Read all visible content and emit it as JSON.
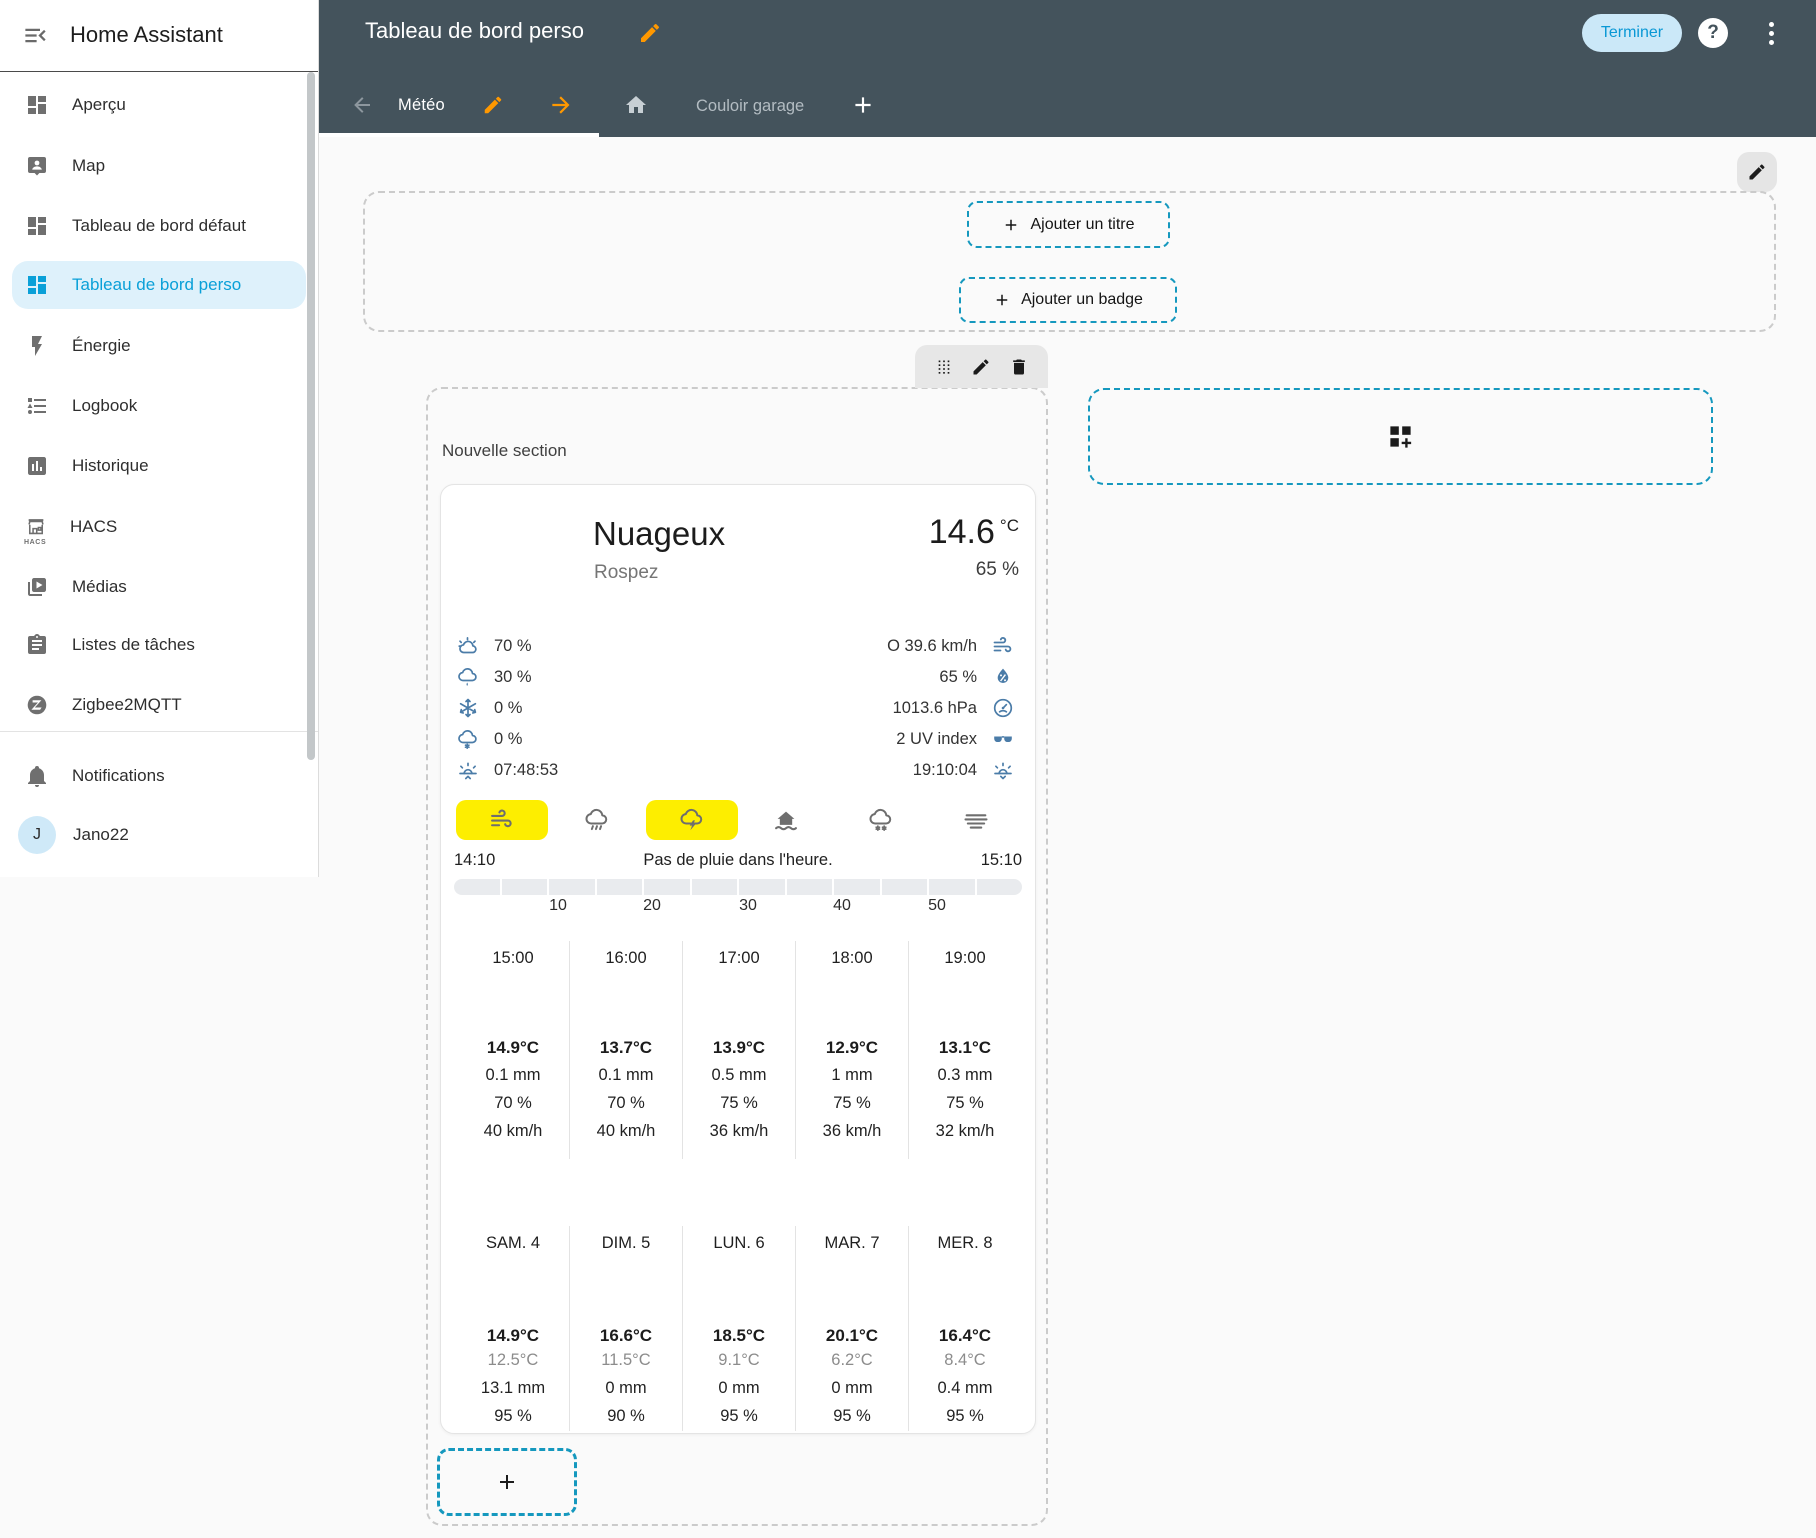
{
  "colors": {
    "header_background": "#44535c",
    "accent_blue": "#0aa0d8",
    "selected_item_background": "#def1fb",
    "dashed_edit_teal": "#1598be",
    "highlight_yellow": "#fdee00",
    "weather_icon_blue": "#4b7ca8",
    "edit_orange": "#ff9800"
  },
  "sidebar": {
    "title": "Home Assistant",
    "items": [
      {
        "label": "Aperçu"
      },
      {
        "label": "Map"
      },
      {
        "label": "Tableau de bord défaut"
      },
      {
        "label": "Tableau de bord perso"
      },
      {
        "label": "Énergie"
      },
      {
        "label": "Logbook"
      },
      {
        "label": "Historique"
      },
      {
        "label": "HACS"
      },
      {
        "label": "Médias"
      },
      {
        "label": "Listes de tâches"
      },
      {
        "label": "Zigbee2MQTT"
      }
    ],
    "hacs_mini_label": "HACS",
    "notifications_label": "Notifications",
    "user": {
      "initial": "J",
      "name": "Jano22"
    }
  },
  "header": {
    "title": "Tableau de bord perso",
    "done_button": "Terminer",
    "help": "?"
  },
  "tabs": {
    "active_label": "Météo",
    "second_label": "Couloir garage"
  },
  "editor": {
    "add_title": "Ajouter un titre",
    "add_badge": "Ajouter un badge",
    "section_title": "Nouvelle section"
  },
  "weather": {
    "state": "Nuageux",
    "location": "Rospez",
    "temperature": "14.6",
    "temperature_unit": "°C",
    "humidity": "65 %",
    "attributes_left": [
      {
        "icon": "partly-cloudy-icon",
        "value": "70 %"
      },
      {
        "icon": "rain-probability-icon",
        "value": "30 %"
      },
      {
        "icon": "snowflake-icon",
        "value": "0 %"
      },
      {
        "icon": "snow-probability-icon",
        "value": "0 %"
      },
      {
        "icon": "sunrise-icon",
        "value": "07:48:53"
      }
    ],
    "attributes_right": [
      {
        "icon": "wind-icon",
        "value": "O 39.6 km/h"
      },
      {
        "icon": "humidity-icon",
        "value": "65 %"
      },
      {
        "icon": "pressure-icon",
        "value": "1013.6 hPa"
      },
      {
        "icon": "uv-icon",
        "value": "2 UV index"
      },
      {
        "icon": "sunset-icon",
        "value": "19:10:04"
      }
    ],
    "condition_toggles": [
      {
        "name": "windy",
        "active": true
      },
      {
        "name": "pouring",
        "active": false
      },
      {
        "name": "lightning-rainy",
        "active": true
      },
      {
        "name": "flood",
        "active": false
      },
      {
        "name": "snowy",
        "active": false
      },
      {
        "name": "fog",
        "active": false
      }
    ],
    "precipitation": {
      "start_time": "14:10",
      "message": "Pas de pluie dans l'heure.",
      "end_time": "15:10",
      "scale": [
        "10",
        "20",
        "30",
        "40",
        "50"
      ]
    },
    "hourly": [
      {
        "time": "15:00",
        "temp": "14.9°C",
        "precipitation": "0.1 mm",
        "humidity": "70 %",
        "wind": "40 km/h"
      },
      {
        "time": "16:00",
        "temp": "13.7°C",
        "precipitation": "0.1 mm",
        "humidity": "70 %",
        "wind": "40 km/h"
      },
      {
        "time": "17:00",
        "temp": "13.9°C",
        "precipitation": "0.5 mm",
        "humidity": "75 %",
        "wind": "36 km/h"
      },
      {
        "time": "18:00",
        "temp": "12.9°C",
        "precipitation": "1 mm",
        "humidity": "75 %",
        "wind": "36 km/h"
      },
      {
        "time": "19:00",
        "temp": "13.1°C",
        "precipitation": "0.3 mm",
        "humidity": "75 %",
        "wind": "32 km/h"
      }
    ],
    "daily": [
      {
        "day": "SAM. 4",
        "high": "14.9°C",
        "low": "12.5°C",
        "precipitation": "13.1 mm",
        "humidity": "95 %"
      },
      {
        "day": "DIM. 5",
        "high": "16.6°C",
        "low": "11.5°C",
        "precipitation": "0 mm",
        "humidity": "90 %"
      },
      {
        "day": "LUN. 6",
        "high": "18.5°C",
        "low": "9.1°C",
        "precipitation": "0 mm",
        "humidity": "95 %"
      },
      {
        "day": "MAR. 7",
        "high": "20.1°C",
        "low": "6.2°C",
        "precipitation": "0 mm",
        "humidity": "95 %"
      },
      {
        "day": "MER. 8",
        "high": "16.4°C",
        "low": "8.4°C",
        "precipitation": "0.4 mm",
        "humidity": "95 %"
      }
    ]
  }
}
